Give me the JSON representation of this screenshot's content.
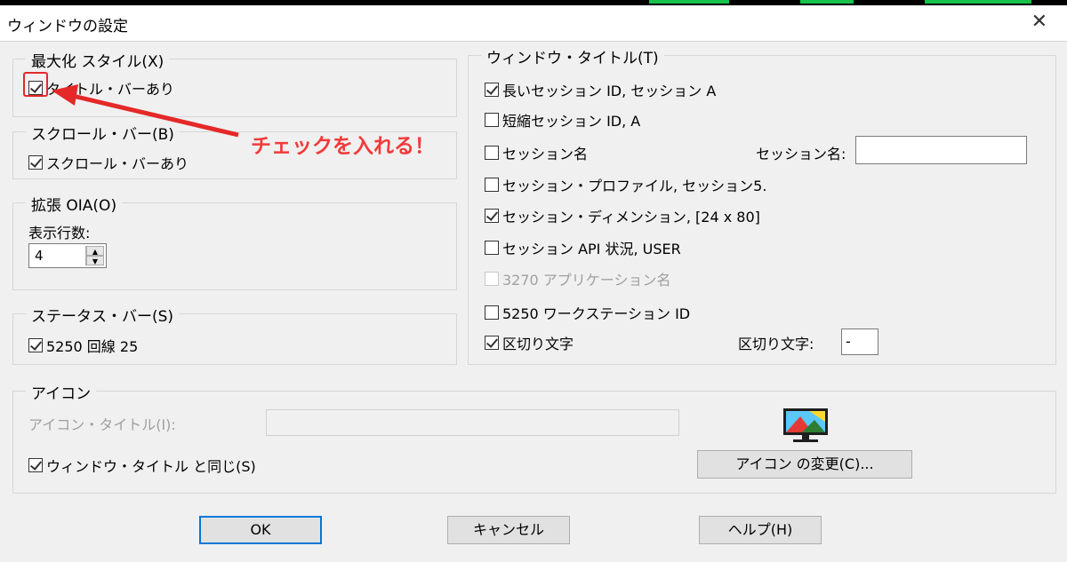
{
  "window": {
    "title": "ウィンドウの設定",
    "close_glyph": "✕"
  },
  "maximize": {
    "legend": "最大化 スタイル(X)",
    "title_bar": {
      "label": "タイトル・バーあり",
      "checked": true
    }
  },
  "scroll": {
    "legend": "スクロール・バー(B)",
    "scroll_bar": {
      "label": "スクロール・バーあり",
      "checked": true
    }
  },
  "oia": {
    "legend": "拡張 OIA(O)",
    "rows_label": "表示行数:",
    "rows_value": "4"
  },
  "status": {
    "legend": "ステータス・バー(S)",
    "line": {
      "label": "5250 回線 25",
      "checked": true
    }
  },
  "window_title": {
    "legend": "ウィンドウ・タイトル(T)",
    "options": [
      {
        "label": "長いセッション ID, セッション A",
        "checked": true
      },
      {
        "label": "短縮セッション ID, A",
        "checked": false
      },
      {
        "label": "セッション名",
        "checked": false
      },
      {
        "label": "セッション・プロファイル, セッション5.",
        "checked": false
      },
      {
        "label": "セッション・ディメンション, [24 x 80]",
        "checked": true
      },
      {
        "label": "セッション API 状況, USER",
        "checked": false
      },
      {
        "label": "3270 アプリケーション名",
        "checked": false,
        "disabled": true
      },
      {
        "label": "5250 ワークステーション ID",
        "checked": false
      },
      {
        "label": "区切り文字",
        "checked": true
      }
    ],
    "session_name_label": "セッション名:",
    "session_name_value": "",
    "delimiter_label": "区切り文字:",
    "delimiter_value": "-"
  },
  "icon": {
    "legend": "アイコン",
    "icon_title_label": "アイコン・タイトル(I):",
    "icon_title_value": "",
    "same_as_title": {
      "label": "ウィンドウ・タイトル と同じ(S)",
      "checked": true
    },
    "change_button": "アイコン の変更(C)..."
  },
  "buttons": {
    "ok": "OK",
    "cancel": "キャンセル",
    "help": "ヘルプ(H)"
  },
  "annotation": {
    "text": "チェックを入れる！",
    "color": "#f23a3a"
  },
  "colors": {
    "accent": "#0078d7",
    "background": "#f0f0f0",
    "annotation_red": "#e52828"
  }
}
